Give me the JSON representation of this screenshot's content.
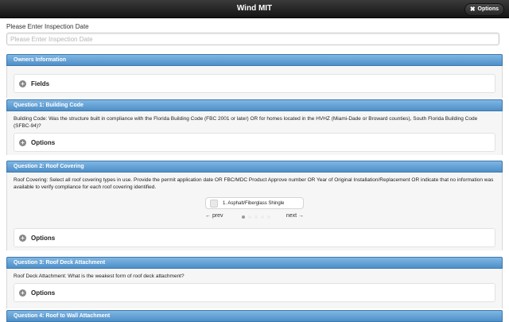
{
  "app": {
    "title": "Wind MIT",
    "options_label": "Options"
  },
  "inspection_date": {
    "label": "Please Enter Inspection Date",
    "placeholder": "Please Enter Inspection Date",
    "value": ""
  },
  "sections": [
    {
      "header": "Owners Information",
      "collapsible": "Fields"
    },
    {
      "header": "Question 1: Building Code",
      "text": "Building Code: Was the structure built in compliance with the Florida Building Code (FBC 2001 or later) OR for homes located in the HVHZ (Miami-Dade or Broward counties), South Florida Building Code (SFBC-94)?",
      "collapsible": "Options"
    },
    {
      "header": "Question 2: Roof Covering",
      "text": "Roof Covering: Select all roof covering types in use. Provide the permit application date OR FBC/MDC Product Approve number OR Year of Original Installation/Replacement OR indicate that no information was available to verify compliance for each roof covering identified.",
      "roof_option": "1. Asphalt/Fiberglass Shingle",
      "prev_label": "← prev",
      "next_label": "next →",
      "collapsible": "Options"
    },
    {
      "header": "Question 3: Roof Deck Attachment",
      "text": "Roof Deck Attachment: What is the weakest form of roof deck attachment?",
      "collapsible": "Options"
    },
    {
      "header": "Question 4: Roof to Wall Attachment"
    }
  ],
  "colors": {
    "topbar": "#1f1f1f",
    "section_header": "#5b9ad1",
    "accent_border": "#3e78ad"
  }
}
